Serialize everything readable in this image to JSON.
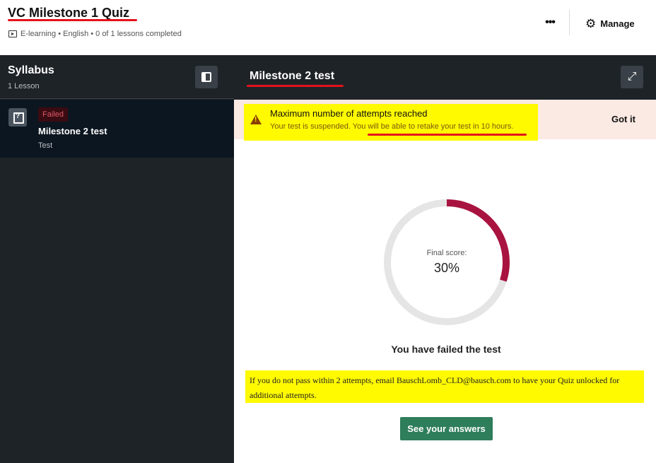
{
  "header": {
    "course_title": "VC Milestone 1 Quiz",
    "meta": "E-learning • English • 0 of 1 lessons completed",
    "more_label": "•••",
    "manage_label": "Manage"
  },
  "sidebar": {
    "title": "Syllabus",
    "subtitle": "1 Lesson",
    "lesson": {
      "status": "Failed",
      "title": "Milestone 2 test",
      "type": "Test"
    }
  },
  "main": {
    "title": "Milestone 2 test",
    "notice": {
      "title": "Maximum number of attempts reached",
      "text": "Your test is suspended. You will be able to retake your test in 10 hours.",
      "dismiss_label": "Got it"
    },
    "score": {
      "label": "Final score:",
      "value": "30%",
      "fraction": 0.3
    },
    "result_text": "You have failed the test",
    "info_text": "If you do not pass within 2 attempts, email BauschLomb_CLD@bausch.com to have your Quiz unlocked for additional attempts.",
    "answers_button": "See your answers"
  },
  "colors": {
    "accent_red": "#e3121b",
    "score_ring": "#a8133f",
    "ring_track": "#e5e5e5",
    "highlight_yellow": "#fffa00",
    "primary_green": "#2e7d5b",
    "dark_panel": "#1e2328"
  }
}
